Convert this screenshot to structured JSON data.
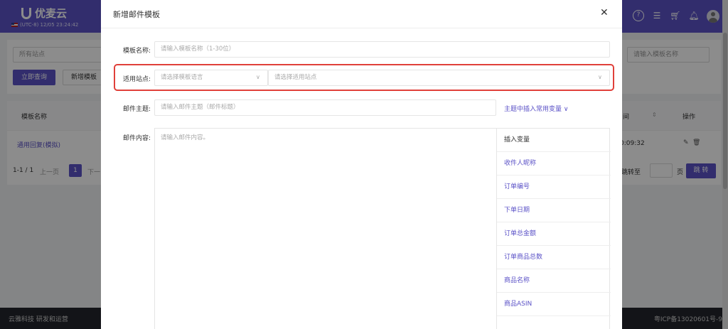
{
  "app": {
    "brand": "优麦云",
    "clock": "(UTC-8) 12/05 23:24:42",
    "top_icons": [
      "help-icon",
      "notes-icon",
      "cart-icon",
      "bell-icon",
      "avatar"
    ]
  },
  "filters": {
    "site_select": "所有站点",
    "query_button": "立即查询",
    "add_template_button": "新增模板",
    "template_search_placeholder": "请输入模板名称"
  },
  "table": {
    "col_name": "模板名称",
    "col_time_fragment": "间",
    "col_actions": "操作",
    "row_name": "通用回复(模拟)",
    "row_time_fragment": "0:09:32",
    "pager_total": "1-1 / 1",
    "pager_prev": "上一页",
    "pager_current": "1",
    "pager_next_fragment": "下一",
    "jump_label_fragment": "跳转至",
    "jump_unit": "页",
    "jump_button": "跳 转"
  },
  "footer": {
    "left": "云雅科技 研发和运营",
    "right": "粤ICP备13020601号-9"
  },
  "modal": {
    "title": "新增邮件模板",
    "close_glyph": "✕",
    "template_name": {
      "label": "模板名称:",
      "placeholder": "请输入模板名称（1-30位）"
    },
    "site": {
      "label": "适用站点:",
      "language_placeholder": "请选择模板语言",
      "site_placeholder": "请选择适用站点"
    },
    "subject": {
      "label": "邮件主题:",
      "placeholder": "请输入邮件主题（邮件标题）",
      "insert_vars_link": "主题中插入常用变量"
    },
    "content": {
      "label": "邮件内容:",
      "placeholder": "请输入邮件内容。"
    },
    "variables": {
      "header": "插入变量",
      "items": [
        "收件人昵称",
        "订单编号",
        "下单日期",
        "订单总金额",
        "订单商品总数",
        "商品名称",
        "商品ASIN"
      ]
    }
  },
  "colors": {
    "brand_purple": "#5b52c7",
    "highlight_red": "#e0403a"
  }
}
